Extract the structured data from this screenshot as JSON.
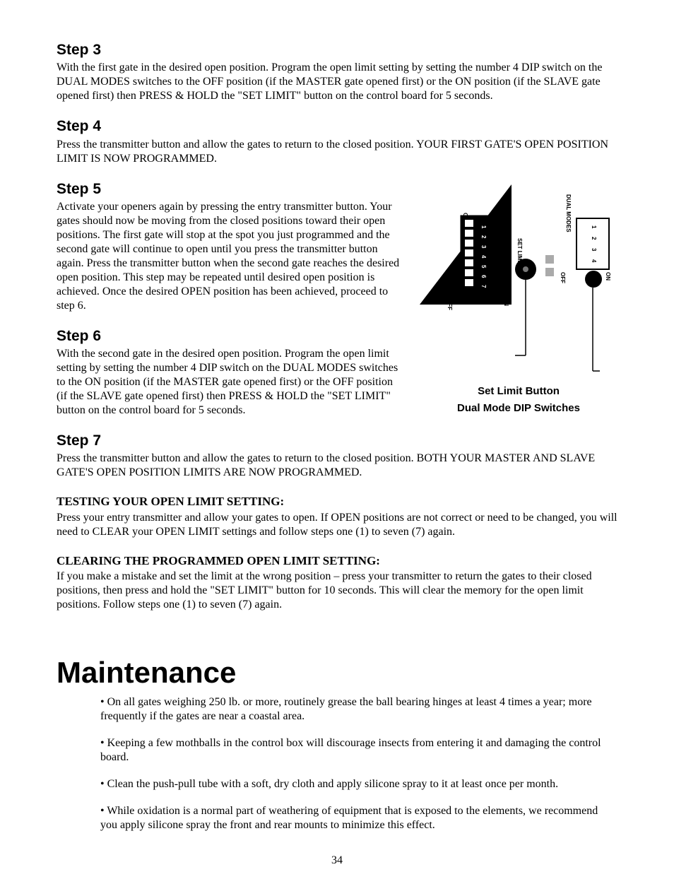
{
  "steps": {
    "s3": {
      "title": "Step 3",
      "body": "With the first gate in the desired open position. Program the open limit setting by setting the number 4 DIP switch on the DUAL MODES switches to the OFF position (if the MASTER gate opened first) or the ON position (if the SLAVE gate opened first) then PRESS & HOLD the \"SET LIMIT\" button on the control board for 5 seconds."
    },
    "s4": {
      "title": "Step 4",
      "body": "Press the transmitter button and allow the gates to return to the closed position. YOUR FIRST GATE'S OPEN POSITION LIMIT IS NOW PROGRAMMED."
    },
    "s5": {
      "title": "Step 5",
      "body": "Activate your openers again by pressing the entry transmitter button. Your gates should now be moving from the closed positions toward their open positions. The first gate will stop at the spot you just programmed and the second gate will continue to open until you press the transmitter button again. Press the transmitter button when the second gate reaches the desired open position. This step may be repeated until desired open position is achieved.  Once the desired OPEN position has been achieved, proceed to step 6."
    },
    "s6": {
      "title": "Step 6",
      "body": "With the second gate in the desired open position. Program the open limit setting by setting the number 4 DIP switch on the DUAL MODES switches to the ON position (if the MASTER gate opened first) or the OFF position (if the SLAVE gate opened first) then PRESS & HOLD the \"SET LIMIT\" button on the control board for 5 seconds."
    },
    "s7": {
      "title": "Step 7",
      "body": "Press the transmitter button and allow the gates to return to the closed position. BOTH YOUR MASTER AND SLAVE GATE'S OPEN POSITION LIMITS ARE NOW PROGRAMMED."
    }
  },
  "testing": {
    "title": "TESTING YOUR OPEN LIMIT SETTING:",
    "body": "Press your entry transmitter and allow your gates to open. If OPEN positions are not correct or need to be changed, you will need to CLEAR your OPEN LIMIT settings and follow steps one (1) to seven (7) again."
  },
  "clearing": {
    "title": "CLEARING THE PROGRAMMED OPEN LIMIT SETTING:",
    "body": "If you make a mistake and set the limit at the wrong position – press your transmitter to return the gates to their closed positions, then press and hold the \"SET LIMIT\" button for 10 seconds. This will clear the memory for the open limit positions. Follow steps one (1) to seven (7) again."
  },
  "maintenance": {
    "title": "Maintenance",
    "items": [
      "• On all gates weighing 250 lb. or more, routinely grease the ball bearing hinges at least 4 times a year; more frequently if the gates are near a coastal area.",
      "• Keeping a few mothballs in the control box will discourage insects from entering it and damaging the control board.",
      "• Clean the push-pull tube with a soft, dry cloth and apply silicone spray to it at least once per month.",
      "• While oxidation is a normal part of weathering of equipment that is exposed to the elements, we recommend you apply silicone spray the front and rear mounts to minimize this effect."
    ]
  },
  "diagram": {
    "callout1": "Set Limit Button",
    "callout2": "Dual Mode DIP Switches",
    "label_set_limit": "SET LIMIT",
    "label_dual_modes": "DUAL MODES",
    "label_on": "ON",
    "label_off": "OFF",
    "dip7": [
      "1",
      "2",
      "3",
      "4",
      "5",
      "6",
      "7"
    ],
    "dip4": [
      "1",
      "2",
      "3",
      "4"
    ]
  },
  "page_number": "34"
}
